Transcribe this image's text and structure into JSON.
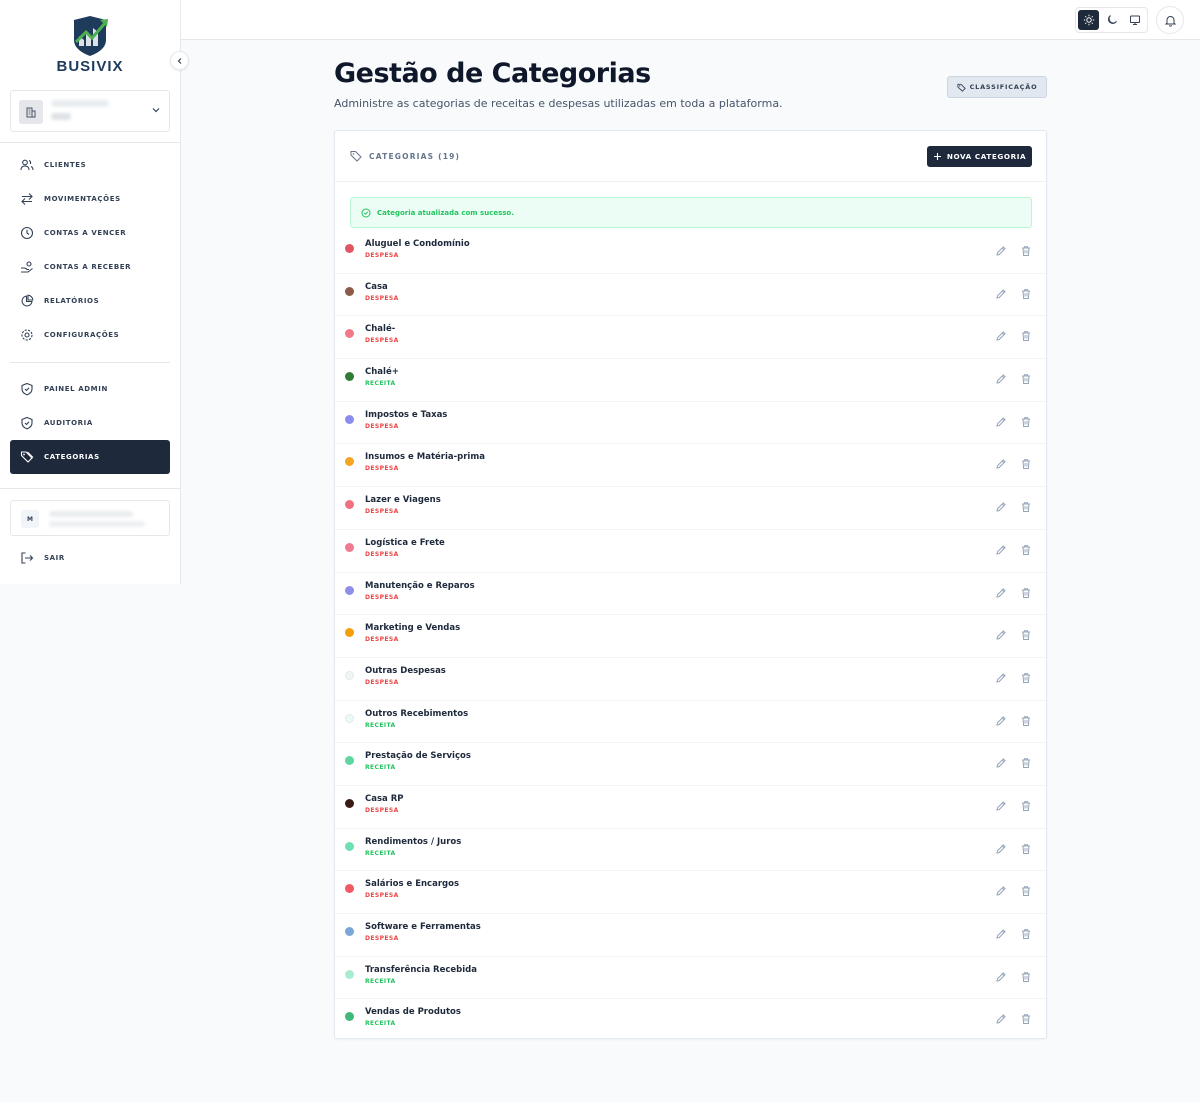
{
  "brand": {
    "name": "BUSIVIX"
  },
  "nav": {
    "main": [
      {
        "label": "CLIENTES",
        "icon": "users-icon"
      },
      {
        "label": "MOVIMENTAÇÕES",
        "icon": "arrows-icon"
      },
      {
        "label": "CONTAS A VENCER",
        "icon": "clock-icon"
      },
      {
        "label": "CONTAS A RECEBER",
        "icon": "hand-coins-icon"
      },
      {
        "label": "RELATÓRIOS",
        "icon": "pie-chart-icon"
      },
      {
        "label": "CONFIGURAÇÕES",
        "icon": "gear-icon"
      }
    ],
    "admin": [
      {
        "label": "PAINEL ADMIN",
        "icon": "shield-icon"
      },
      {
        "label": "AUDITORIA",
        "icon": "shield-check-icon"
      },
      {
        "label": "CATEGORIAS",
        "icon": "tags-icon",
        "active": true
      }
    ],
    "user_initial": "M",
    "logout": "SAIR"
  },
  "page": {
    "title": "Gestão de Categorias",
    "subtitle": "Administre as categorias de receitas e despesas utilizadas em toda a plataforma.",
    "classification_button": "CLASSIFICAÇÃO"
  },
  "card": {
    "title": "CATEGORIAS (19)",
    "new_button": "NOVA CATEGORIA",
    "alert": "Categoria atualizada com sucesso."
  },
  "categories": [
    {
      "name": "Aluguel e Condomínio",
      "type": "DESPESA",
      "color": "#e05563"
    },
    {
      "name": "Casa",
      "type": "DESPESA",
      "color": "#8b5a4a"
    },
    {
      "name": "Chalé-",
      "type": "DESPESA",
      "color": "#f07a8a"
    },
    {
      "name": "Chalé+",
      "type": "RECEITA",
      "color": "#2e7d32"
    },
    {
      "name": "Impostos e Taxas",
      "type": "DESPESA",
      "color": "#8b8cf0"
    },
    {
      "name": "Insumos e Matéria-prima",
      "type": "DESPESA",
      "color": "#f5a524"
    },
    {
      "name": "Lazer e Viagens",
      "type": "DESPESA",
      "color": "#f06f82"
    },
    {
      "name": "Logística e Frete",
      "type": "DESPESA",
      "color": "#f07a90"
    },
    {
      "name": "Manutenção e Reparos",
      "type": "DESPESA",
      "color": "#8f8de8"
    },
    {
      "name": "Marketing e Vendas",
      "type": "DESPESA",
      "color": "#f59e0b"
    },
    {
      "name": "Outras Despesas",
      "type": "DESPESA",
      "color": "#f1f5f4"
    },
    {
      "name": "Outros Recebimentos",
      "type": "RECEITA",
      "color": "#ecfbf5"
    },
    {
      "name": "Prestação de Serviços",
      "type": "RECEITA",
      "color": "#5ed6a0"
    },
    {
      "name": "Casa RP",
      "type": "DESPESA",
      "color": "#3b1a12"
    },
    {
      "name": "Rendimentos / Juros",
      "type": "RECEITA",
      "color": "#6ee0b4"
    },
    {
      "name": "Salários e Encargos",
      "type": "DESPESA",
      "color": "#ef5a66"
    },
    {
      "name": "Software e Ferramentas",
      "type": "DESPESA",
      "color": "#7aa7d8"
    },
    {
      "name": "Transferência Recebida",
      "type": "RECEITA",
      "color": "#a8ecd0"
    },
    {
      "name": "Vendas de Produtos",
      "type": "RECEITA",
      "color": "#3fb87a"
    }
  ]
}
